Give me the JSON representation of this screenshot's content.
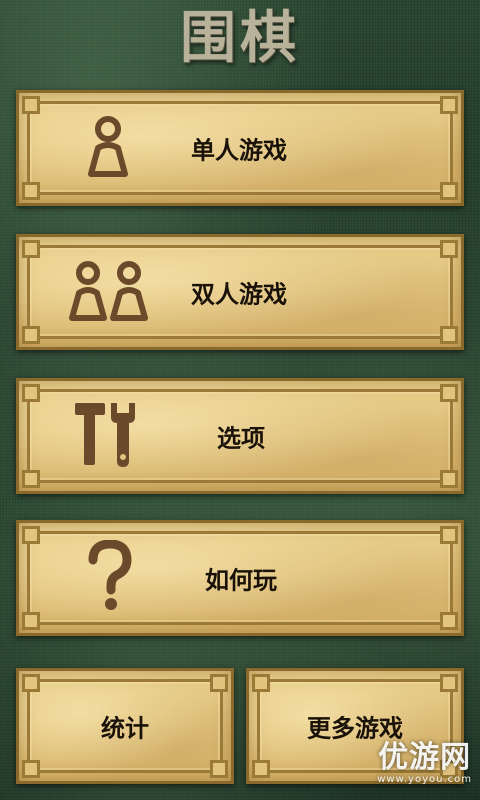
{
  "app": {
    "title": "围棋"
  },
  "menu": {
    "single_player": {
      "label": "单人游戏",
      "icon": "single-person-icon"
    },
    "two_player": {
      "label": "双人游戏",
      "icon": "two-persons-icon"
    },
    "options": {
      "label": "选项",
      "icon": "tools-icon"
    },
    "how_to_play": {
      "label": "如何玩",
      "icon": "question-mark-icon"
    },
    "stats": {
      "label": "统计"
    },
    "more_games": {
      "label": "更多游戏"
    }
  },
  "watermark": {
    "main": "优游网",
    "sub": "www.yoyou.com"
  },
  "colors": {
    "card_fill": "#e2c47e",
    "card_border": "#9a7a36",
    "icon_brown": "#6a4a2a",
    "title_color": "#b9b29a",
    "background": "#2b4832"
  }
}
